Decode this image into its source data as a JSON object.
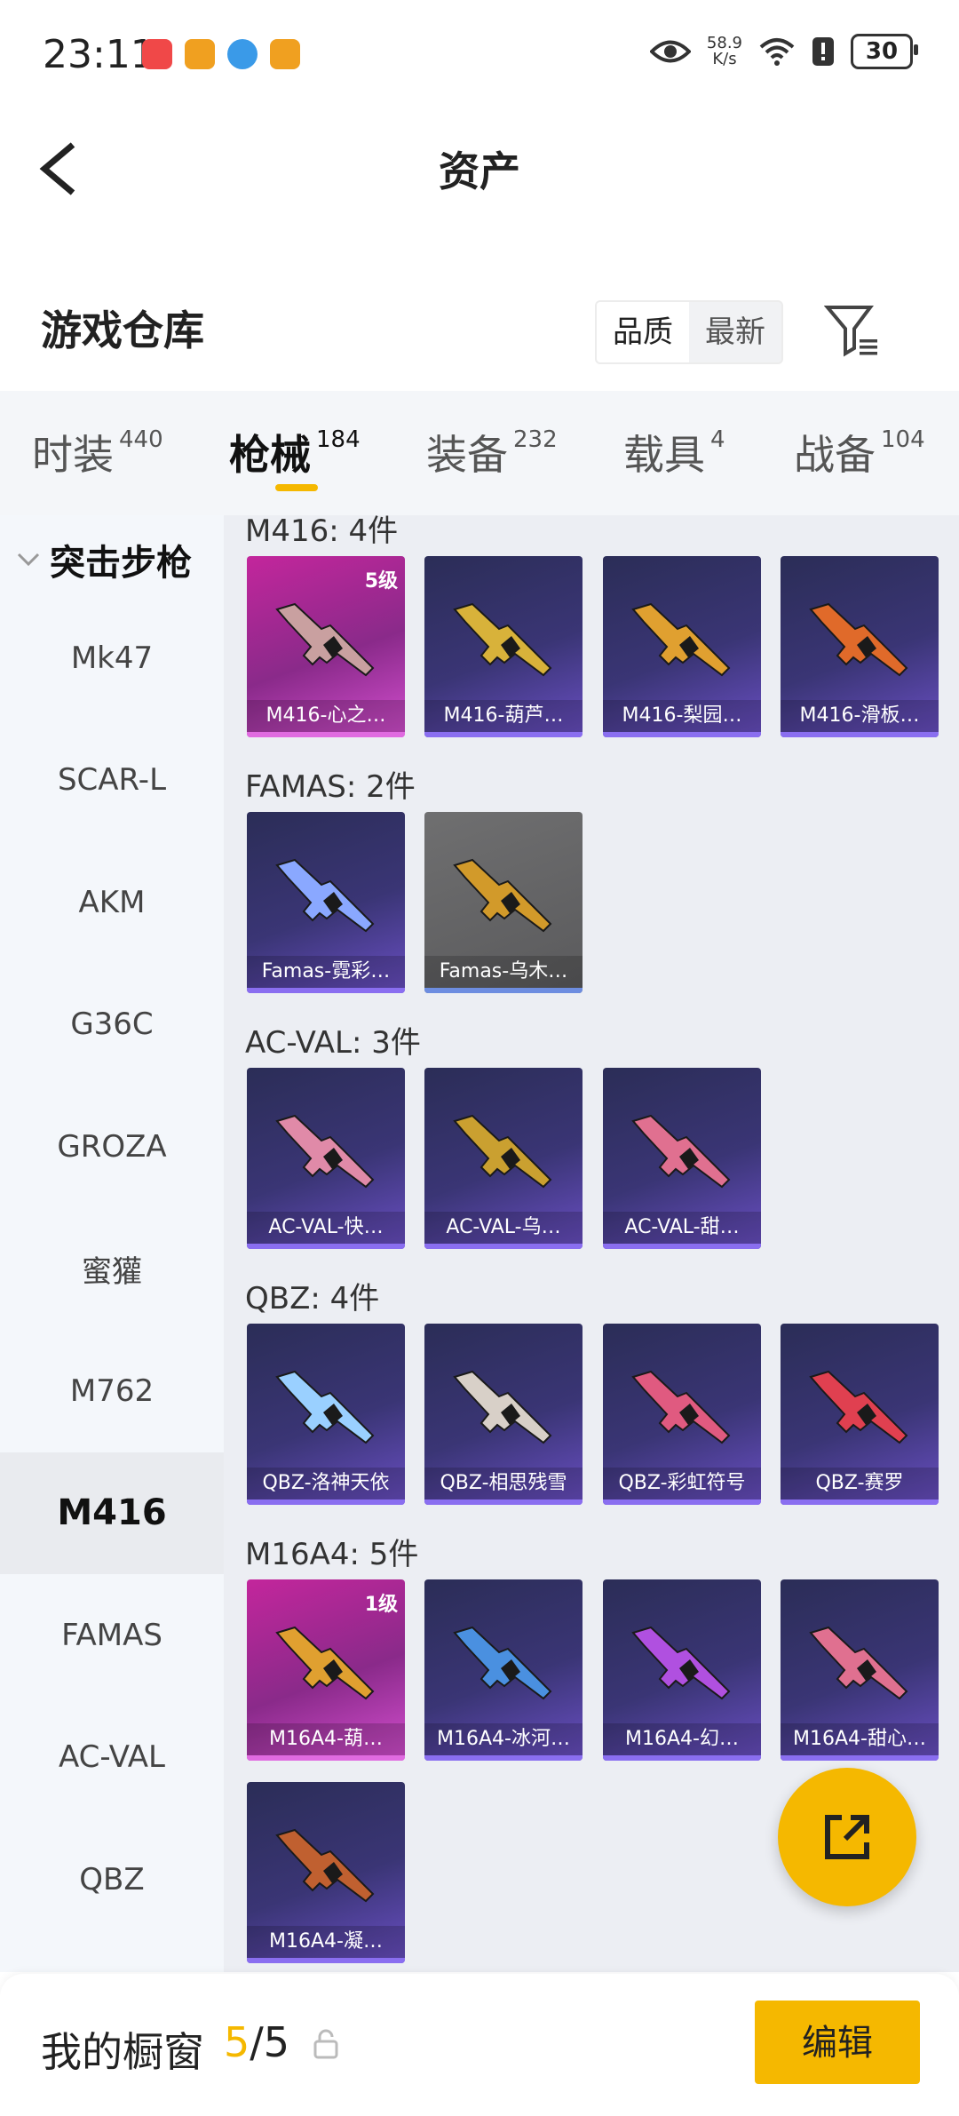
{
  "status_bar": {
    "time": "23:11",
    "net_speed_value": "58.9",
    "net_speed_unit": "K/s",
    "battery": "30",
    "icons": [
      "app-red-icon",
      "app-orange-icon",
      "app-blue-icon",
      "app-orange-icon",
      "eye-icon",
      "wifi-icon",
      "alert-icon",
      "battery-icon"
    ]
  },
  "header": {
    "title": "资产",
    "back_icon": "chevron-left-icon"
  },
  "warehouse": {
    "title": "游戏仓库",
    "sort_options": [
      "品质",
      "最新"
    ],
    "sort_selected": "品质",
    "filter_icon": "filter-icon"
  },
  "tabs": [
    {
      "label": "时装",
      "count": "440",
      "active": false
    },
    {
      "label": "枪械",
      "count": "184",
      "active": true
    },
    {
      "label": "装备",
      "count": "232",
      "active": false
    },
    {
      "label": "载具",
      "count": "4",
      "active": false
    },
    {
      "label": "战备",
      "count": "104",
      "active": false
    }
  ],
  "sidebar": {
    "header": "突击步枪",
    "items": [
      {
        "label": "Mk47",
        "active": false
      },
      {
        "label": "SCAR-L",
        "active": false
      },
      {
        "label": "AKM",
        "active": false
      },
      {
        "label": "G36C",
        "active": false
      },
      {
        "label": "GROZA",
        "active": false
      },
      {
        "label": "蜜獾",
        "active": false
      },
      {
        "label": "M762",
        "active": false
      },
      {
        "label": "M416",
        "active": true
      },
      {
        "label": "FAMAS",
        "active": false
      },
      {
        "label": "AC-VAL",
        "active": false
      },
      {
        "label": "QBZ",
        "active": false
      }
    ]
  },
  "groups": [
    {
      "title": "M416: 4件",
      "items": [
        {
          "name": "M416-心之…",
          "level": "5级",
          "style": "pink",
          "accent": "#c9a0a0"
        },
        {
          "name": "M416-葫芦…",
          "level": "",
          "style": "blue",
          "accent": "#d8b23a"
        },
        {
          "name": "M416-梨园…",
          "level": "",
          "style": "blue",
          "accent": "#e0a030"
        },
        {
          "name": "M416-滑板…",
          "level": "",
          "style": "blue",
          "accent": "#e06a2a"
        }
      ]
    },
    {
      "title": "FAMAS: 2件",
      "items": [
        {
          "name": "Famas-霓彩…",
          "level": "",
          "style": "blue",
          "accent": "#8aa8ff"
        },
        {
          "name": "Famas-乌木…",
          "level": "",
          "style": "gray",
          "accent": "#d29a2a"
        }
      ]
    },
    {
      "title": "AC-VAL: 3件",
      "items": [
        {
          "name": "AC-VAL-快…",
          "level": "",
          "style": "blue",
          "accent": "#e08aa8"
        },
        {
          "name": "AC-VAL-乌…",
          "level": "",
          "style": "blue",
          "accent": "#caa030"
        },
        {
          "name": "AC-VAL-甜…",
          "level": "",
          "style": "blue",
          "accent": "#e07090"
        }
      ]
    },
    {
      "title": "QBZ: 4件",
      "items": [
        {
          "name": "QBZ-洛神天依",
          "level": "",
          "style": "blue",
          "accent": "#9ad0ff"
        },
        {
          "name": "QBZ-相思残雪",
          "level": "",
          "style": "blue",
          "accent": "#d8d0c8"
        },
        {
          "name": "QBZ-彩虹符号",
          "level": "",
          "style": "blue",
          "accent": "#e05a80"
        },
        {
          "name": "QBZ-赛罗",
          "level": "",
          "style": "blue",
          "accent": "#e04050"
        }
      ]
    },
    {
      "title": "M16A4: 5件",
      "items": [
        {
          "name": "M16A4-葫…",
          "level": "1级",
          "style": "pink",
          "accent": "#e0a030"
        },
        {
          "name": "M16A4-冰河…",
          "level": "",
          "style": "blue",
          "accent": "#4a90e0"
        },
        {
          "name": "M16A4-幻…",
          "level": "",
          "style": "blue",
          "accent": "#b050e0"
        },
        {
          "name": "M16A4-甜心…",
          "level": "",
          "style": "blue",
          "accent": "#e07090"
        },
        {
          "name": "M16A4-凝…",
          "level": "",
          "style": "blue",
          "accent": "#c06030"
        }
      ]
    }
  ],
  "share_fab": {
    "icon": "share-icon"
  },
  "bottom_bar": {
    "label": "我的橱窗",
    "count_current": "5",
    "count_total": "/5",
    "lock_icon": "lock-icon",
    "edit_label": "编辑"
  },
  "colors": {
    "accent": "#f5b800",
    "card_blue": "#3a3575",
    "card_pink": "#c3269c"
  }
}
